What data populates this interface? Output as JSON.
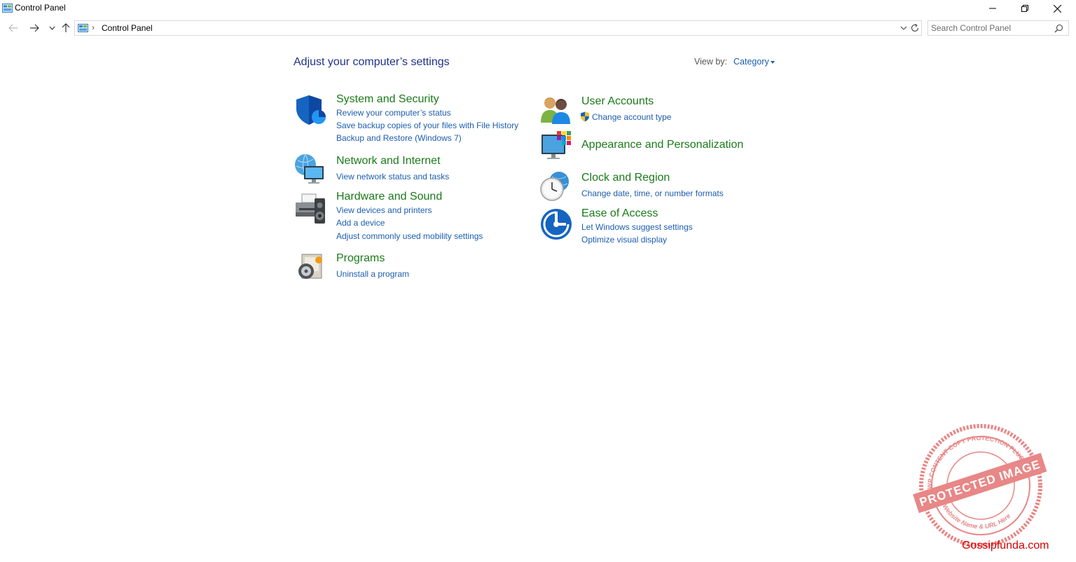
{
  "window": {
    "title": "Control Panel",
    "controls": {
      "minimize": "minimize-icon",
      "maximize": "restore-icon",
      "close": "close-icon"
    }
  },
  "navigation": {
    "breadcrumb": "Control Panel",
    "search_placeholder": "Search Control Panel"
  },
  "main": {
    "heading": "Adjust your computer’s settings",
    "view_by_label": "View by:",
    "view_by_value": "Category"
  },
  "categories": {
    "system_security": {
      "title": "System and Security",
      "icon": "shield-icon",
      "links": [
        "Review your computer’s status",
        "Save backup copies of your files with File History",
        "Backup and Restore (Windows 7)"
      ]
    },
    "network_internet": {
      "title": "Network and Internet",
      "icon": "network-globe-icon",
      "links": [
        "View network status and tasks"
      ]
    },
    "hardware_sound": {
      "title": "Hardware and Sound",
      "icon": "printer-speaker-icon",
      "links": [
        "View devices and printers",
        "Add a device",
        "Adjust commonly used mobility settings"
      ]
    },
    "programs": {
      "title": "Programs",
      "icon": "programs-box-icon",
      "links": [
        "Uninstall a program"
      ]
    },
    "user_accounts": {
      "title": "User Accounts",
      "icon": "users-icon",
      "links": [
        "Change account type"
      ]
    },
    "appearance": {
      "title": "Appearance and Personalization",
      "icon": "monitor-palette-icon",
      "links": []
    },
    "clock_region": {
      "title": "Clock and Region",
      "icon": "clock-globe-icon",
      "links": [
        "Change date, time, or number formats"
      ]
    },
    "ease_access": {
      "title": "Ease of Access",
      "icon": "ease-of-access-icon",
      "links": [
        "Let Windows suggest settings",
        "Optimize visual display"
      ]
    }
  },
  "watermark": {
    "text": "PROTECTED IMAGE",
    "ring_top": "WP CONTENT COPY PROTECTION PLUGIN",
    "ring_bottom": "My Website Name & URL Here",
    "site": "Gossipfunda.com"
  },
  "colors": {
    "heading": "#1e3287",
    "category_title": "#1a7a1a",
    "link": "#1c5db0",
    "watermark": "#d40000"
  }
}
